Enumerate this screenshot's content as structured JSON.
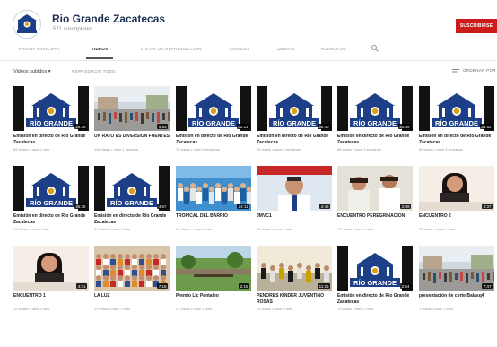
{
  "channel": {
    "name": "Rio Grande Zacatecas",
    "subscribers": "571 suscriptores",
    "subscribe_label": "SUSCRIBIRSE"
  },
  "tabs": [
    {
      "label": "PÁGINA PRINCIPAL",
      "active": false
    },
    {
      "label": "VIDEOS",
      "active": true
    },
    {
      "label": "LISTAS DE REPRODUCCIÓN",
      "active": false
    },
    {
      "label": "CANALES",
      "active": false
    },
    {
      "label": "DEBATE",
      "active": false
    },
    {
      "label": "ACERCA DE",
      "active": false
    }
  ],
  "filters": {
    "dropdown_label": "Videos subidos ▾",
    "play_all": "REPRODUCIR TODO",
    "sort_label": "ORDENAR POR"
  },
  "thumb_style": {
    "brand_blue": "#1c3f87",
    "logo_text": "RÍO GRANDE"
  },
  "videos": [
    {
      "title": "Emisión en directo de Río Grande Zacatecas",
      "meta": "68 vistas • hace 1 mes",
      "duration": "26:36",
      "thumb": "logo"
    },
    {
      "title": "UN RATO ES DIVERSIÓN FUENTES",
      "meta": "108 vistas • hace 1 semana",
      "duration": "4:53",
      "thumb": "plaza"
    },
    {
      "title": "Emisión en directo de Río Grande Zacatecas",
      "meta": "78 vistas • hace 2 semanas",
      "duration": "02:13",
      "thumb": "logo"
    },
    {
      "title": "Emisión en directo de Río Grande Zacatecas",
      "meta": "65 vistas • hace 2 semanas",
      "duration": "35:40",
      "thumb": "logo"
    },
    {
      "title": "Emisión en directo de Río Grande Zacatecas",
      "meta": "88 vistas • hace 3 semanas",
      "duration": "40:09",
      "thumb": "logo"
    },
    {
      "title": "Emisión en directo de Río Grande Zacatecas",
      "meta": "82 vistas • hace 3 semanas",
      "duration": "33:52",
      "thumb": "logo"
    },
    {
      "title": "Emisión en directo de Río Grande Zacatecas",
      "meta": "73 vistas • hace 1 mes",
      "duration": "35:36",
      "thumb": "logo"
    },
    {
      "title": "Emisión en directo de Río Grande Zacatecas",
      "meta": "81 vistas • hace 1 mes",
      "duration": "4:57",
      "thumb": "logo"
    },
    {
      "title": "TROPICAL DEL BARRIO",
      "meta": "41 vistas • hace 1 mes",
      "duration": "24:11",
      "thumb": "crowd"
    },
    {
      "title": "JMVC1",
      "meta": "63 vistas • hace 1 mes",
      "duration": "4:48",
      "thumb": "man"
    },
    {
      "title": "ENCUENTRO PEREGRINACIÓN",
      "meta": "72 vistas • hace 1 mes",
      "duration": "2:49",
      "thumb": "women"
    },
    {
      "title": "ENCUENTRO 2",
      "meta": "30 vistas • hace 1 mes",
      "duration": "4:37",
      "thumb": "girl"
    },
    {
      "title": "ENCUENTRO 1",
      "meta": "12 vistas • hace 1 mes",
      "duration": "4:41",
      "thumb": "girl"
    },
    {
      "title": "LA LUZ",
      "meta": "19 vistas • hace 1 mes",
      "duration": "7:16",
      "thumb": "event"
    },
    {
      "title": "Premio Lic Pantaleo",
      "meta": "23 vistas • hace 1 mes",
      "duration": "2:15",
      "thumb": "park"
    },
    {
      "title": "PEÑORES KINDER JUVENTINO ROSAS",
      "meta": "51 vistas • hace 1 mes",
      "duration": "11:25",
      "thumb": "kids"
    },
    {
      "title": "Emisión en directo de Río Grande Zacatecas",
      "meta": "70 vistas • hace 1 mes",
      "duration": "2:24",
      "thumb": "logo"
    },
    {
      "title": "presentación de corte Balasq4",
      "meta": "1 vistas • hace 1 mes",
      "duration": "7:47",
      "thumb": "plaza"
    }
  ]
}
